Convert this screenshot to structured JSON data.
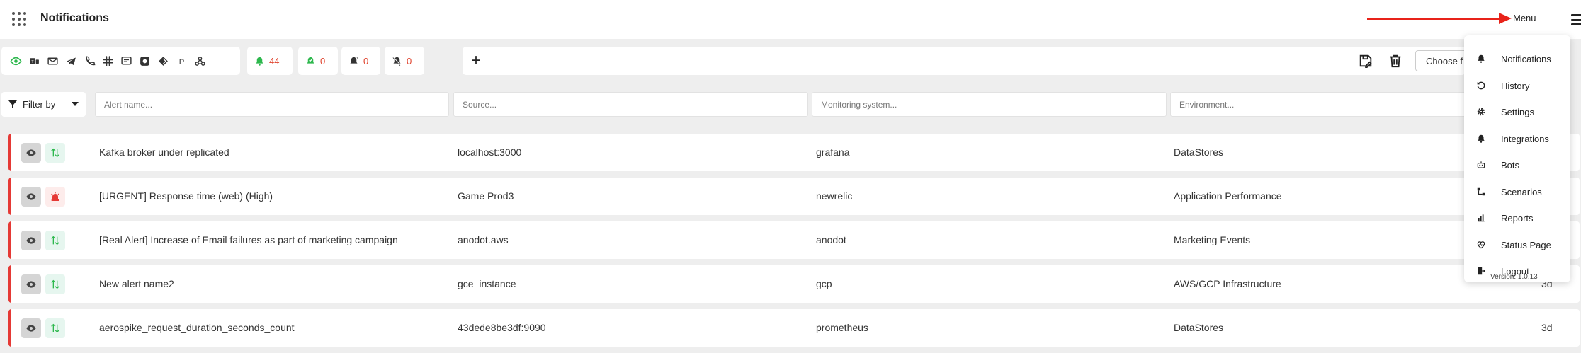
{
  "header": {
    "title": "Notifications",
    "menu_label": "Menu"
  },
  "toolbar": {
    "integration_icons": [
      "eye-icon",
      "teams-icon",
      "mail-icon",
      "telegram-icon",
      "phone-icon",
      "slack-icon",
      "message-icon",
      "mattermost-icon",
      "diamond-icon",
      "pagerduty-icon",
      "webhook-icon"
    ],
    "counts": [
      {
        "name": "alert",
        "value": "44",
        "color": "#2db84d"
      },
      {
        "name": "acknowledged",
        "value": "0",
        "color": "#2db84d"
      },
      {
        "name": "snoozed",
        "value": "0",
        "color": "#333333"
      },
      {
        "name": "muted",
        "value": "0",
        "color": "#333333"
      }
    ],
    "plus_label": "+",
    "choose_label": "Choose f"
  },
  "filters": {
    "filter_label": "Filter by",
    "alert_placeholder": "Alert name...",
    "source_placeholder": "Source...",
    "monitoring_placeholder": "Monitoring system...",
    "environment_placeholder": "Environment..."
  },
  "alerts": [
    {
      "name": "Kafka broker under replicated",
      "source": "localhost:3000",
      "monitoring": "grafana",
      "environment": "DataStores",
      "age": "",
      "status": "resolved"
    },
    {
      "name": "[URGENT] Response time (web) (High)",
      "source": "Game Prod3",
      "monitoring": "newrelic",
      "environment": "Application Performance",
      "age": "",
      "status": "urgent"
    },
    {
      "name": "[Real Alert] Increase of Email failures as part of marketing campaign",
      "source": "anodot.aws",
      "monitoring": "anodot",
      "environment": "Marketing Events",
      "age": "",
      "status": "resolved"
    },
    {
      "name": "New alert name2",
      "source": "gce_instance",
      "monitoring": "gcp",
      "environment": "AWS/GCP Infrastructure",
      "age": "3d",
      "status": "resolved"
    },
    {
      "name": "aerospike_request_duration_seconds_count",
      "source": "43dede8be3df:9090",
      "monitoring": "prometheus",
      "environment": "DataStores",
      "age": "3d",
      "status": "resolved"
    }
  ],
  "menu": {
    "items": [
      {
        "label": "Notifications",
        "icon": "bell-icon"
      },
      {
        "label": "History",
        "icon": "history-icon"
      },
      {
        "label": "Settings",
        "icon": "gear-icon"
      },
      {
        "label": "Integrations",
        "icon": "bell-icon"
      },
      {
        "label": "Bots",
        "icon": "robot-icon"
      },
      {
        "label": "Scenarios",
        "icon": "scenarios-icon"
      },
      {
        "label": "Reports",
        "icon": "chart-icon"
      },
      {
        "label": "Status Page",
        "icon": "heart-pulse-icon"
      },
      {
        "label": "Logout",
        "icon": "logout-icon"
      }
    ],
    "version": "Version: 1.0.13"
  },
  "colors": {
    "alert_border": "#e53935",
    "annotation_arrow": "#e8231a",
    "count_text": "#e0442f",
    "status_green": "#2db84d"
  }
}
